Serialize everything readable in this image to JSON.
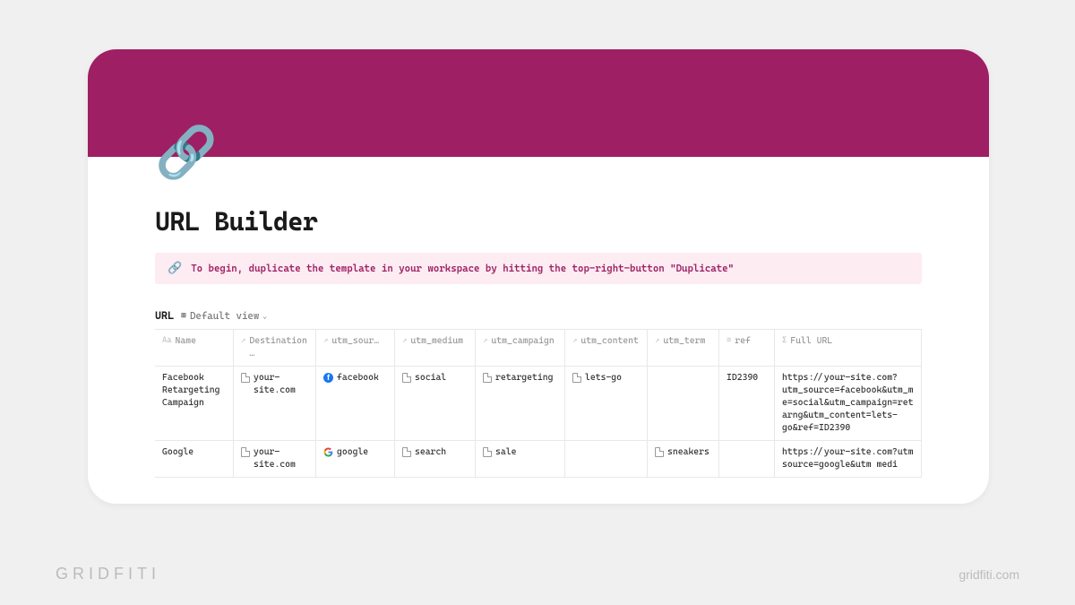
{
  "page": {
    "icon": "🔗",
    "title": "URL Builder"
  },
  "callout": {
    "icon": "🔗",
    "text": "To begin, duplicate the template in your workspace by hitting the top-right-button \"Duplicate\""
  },
  "database": {
    "title": "URL",
    "view_label": "Default view",
    "columns": [
      {
        "icon": "Aa",
        "label": "Name"
      },
      {
        "icon": "↗",
        "label": "Destination …"
      },
      {
        "icon": "↗",
        "label": "utm_sour…"
      },
      {
        "icon": "↗",
        "label": "utm_medium"
      },
      {
        "icon": "↗",
        "label": "utm_campaign"
      },
      {
        "icon": "↗",
        "label": "utm_content"
      },
      {
        "icon": "↗",
        "label": "utm_term"
      },
      {
        "icon": "≡",
        "label": "ref"
      },
      {
        "icon": "Σ",
        "label": "Full URL"
      }
    ],
    "rows": [
      {
        "name": "Facebook Retargeting Campaign",
        "destination": "your-site.com",
        "utm_source": "facebook",
        "source_icon": "facebook",
        "utm_medium": "social",
        "utm_campaign": "retargeting",
        "utm_content": "lets-go",
        "utm_term": "",
        "ref": "ID2390",
        "full_url": "https://your-site.com?utm_source=facebook&utm_me=social&utm_campaign=retarng&utm_content=lets-go&ref=ID2390"
      },
      {
        "name": "Google",
        "destination": "your-site.com",
        "utm_source": "google",
        "source_icon": "google",
        "utm_medium": "search",
        "utm_campaign": "sale",
        "utm_content": "",
        "utm_term": "sneakers",
        "ref": "",
        "full_url": "https://your-site.com?utm source=google&utm medi"
      }
    ]
  },
  "branding": {
    "left": "GRIDFITI",
    "right": "gridfiti.com"
  }
}
